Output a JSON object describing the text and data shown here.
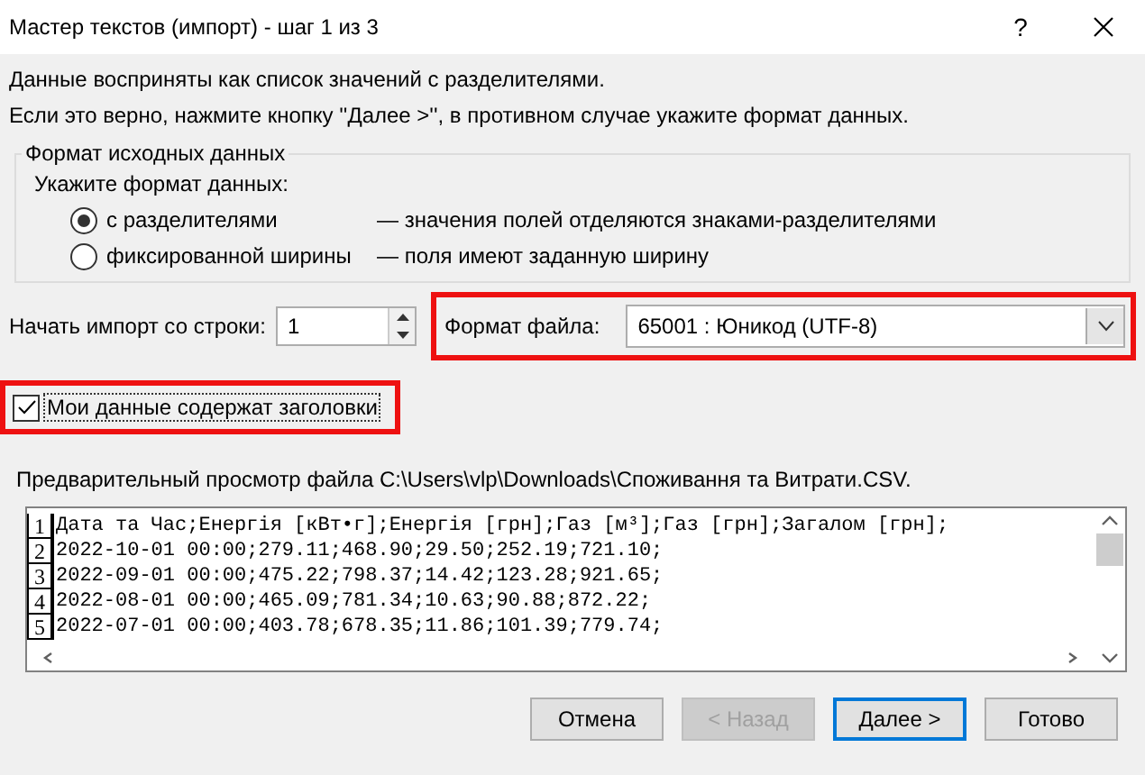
{
  "window": {
    "title": "Мастер текстов (импорт) - шаг 1 из 3",
    "help": "?"
  },
  "intro": [
    "Данные восприняты как список значений с разделителями.",
    "Если это верно, нажмите кнопку ''Далее >'', в противном случае укажите формат данных."
  ],
  "source_format": {
    "legend": "Формат исходных данных",
    "prompt": "Укажите формат данных:",
    "options": [
      {
        "label": "с разделителями",
        "description": "— значения полей отделяются знаками-разделителями",
        "selected": true
      },
      {
        "label": "фиксированной ширины",
        "description": "— поля имеют заданную ширину",
        "selected": false
      }
    ]
  },
  "start_row": {
    "label": "Начать импорт со строки:",
    "value": "1"
  },
  "file_format": {
    "label": "Формат файла:",
    "value": "65001 : Юникод (UTF-8)"
  },
  "headers": {
    "label": "Мои данные содержат заголовки",
    "checked": true
  },
  "preview": {
    "label": "Предварительный просмотр файла C:\\Users\\vlp\\Downloads\\Споживання та Витрати.CSV.",
    "lines": [
      {
        "number": "1",
        "text": "Дата та Час;Енергія [кВт•г];Енергія [грн];Газ [м³];Газ [грн];Загалом [грн];"
      },
      {
        "number": "2",
        "text": "2022-10-01 00:00;279.11;468.90;29.50;252.19;721.10;"
      },
      {
        "number": "3",
        "text": "2022-09-01 00:00;475.22;798.37;14.42;123.28;921.65;"
      },
      {
        "number": "4",
        "text": "2022-08-01 00:00;465.09;781.34;10.63;90.88;872.22;"
      },
      {
        "number": "5",
        "text": "2022-07-01 00:00;403.78;678.35;11.86;101.39;779.74;"
      }
    ]
  },
  "buttons": [
    {
      "label": "Отмена",
      "disabled": false,
      "default": false
    },
    {
      "label": "< Назад",
      "disabled": true,
      "default": false
    },
    {
      "label": "Далее >",
      "disabled": false,
      "default": true
    },
    {
      "label": "Готово",
      "disabled": false,
      "default": false
    }
  ]
}
